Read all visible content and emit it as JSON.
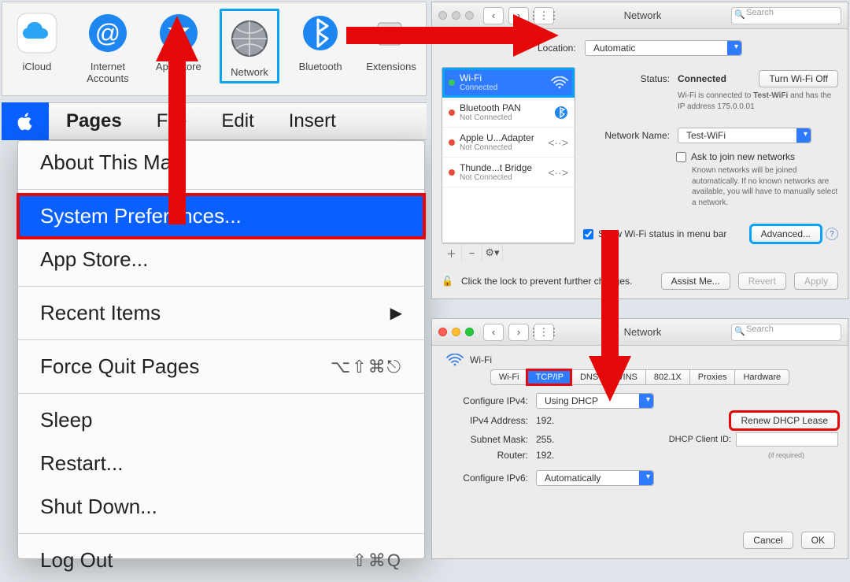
{
  "sp_icons": {
    "icloud": "iCloud",
    "internet": "Internet\nAccounts",
    "appstore": "App Store",
    "network": "Network",
    "bluetooth": "Bluetooth",
    "extensions": "Extensions"
  },
  "menubar": {
    "app": "Pages",
    "items": [
      "File",
      "Edit",
      "Insert"
    ]
  },
  "dropdown": {
    "about": "About This Mac",
    "sysprefs": "System Preferences...",
    "appstore": "App Store...",
    "recent": "Recent Items",
    "forcequit": "Force Quit Pages",
    "forcequit_shortcut": "⌥⇧⌘⎋",
    "sleep": "Sleep",
    "restart": "Restart...",
    "shutdown": "Shut Down...",
    "logout": "Log Out",
    "logout_shortcut": "⇧⌘Q"
  },
  "net1": {
    "title": "Network",
    "search_placeholder": "Search",
    "location_label": "Location:",
    "location_value": "Automatic",
    "sidebar": [
      {
        "name": "Wi-Fi",
        "sub": "Connected",
        "status": "g",
        "icon": "wifi"
      },
      {
        "name": "Bluetooth PAN",
        "sub": "Not Connected",
        "status": "r",
        "icon": "bt"
      },
      {
        "name": "Apple U...Adapter",
        "sub": "Not Connected",
        "status": "r",
        "icon": "eth"
      },
      {
        "name": "Thunde...t Bridge",
        "sub": "Not Connected",
        "status": "r",
        "icon": "eth"
      }
    ],
    "status_label": "Status:",
    "status_value": "Connected",
    "turn_off": "Turn Wi-Fi Off",
    "connected_text_pre": "Wi-Fi is connected to ",
    "connected_ssid": "Test-WiFi",
    "connected_text_post": " and has the IP address ",
    "ip": "175.0.0.01",
    "netname_label": "Network Name:",
    "netname_value": "Test-WiFi",
    "ask_label": "Ask to join new networks",
    "ask_help": "Known networks will be joined automatically. If no known networks are available, you will have to manually select a network.",
    "show_status": "Show Wi-Fi status in menu bar",
    "advanced": "Advanced...",
    "lock_text": "Click the lock to prevent further changes.",
    "assist": "Assist Me...",
    "revert": "Revert",
    "apply": "Apply"
  },
  "net2": {
    "title": "Network",
    "search_placeholder": "Search",
    "wifi_label": "Wi-Fi",
    "tabs": [
      "Wi-Fi",
      "TCP/IP",
      "DNS",
      "WINS",
      "802.1X",
      "Proxies",
      "Hardware"
    ],
    "active_tab": 1,
    "cfg4_label": "Configure IPv4:",
    "cfg4_value": "Using DHCP",
    "ipv4_label": "IPv4 Address:",
    "ipv4_value": "192.",
    "mask_label": "Subnet Mask:",
    "mask_value": "255.",
    "router_label": "Router:",
    "router_value": "192.",
    "renew": "Renew DHCP Lease",
    "clientid_label": "DHCP Client ID:",
    "clientid_note": "(if required)",
    "cfg6_label": "Configure IPv6:",
    "cfg6_value": "Automatically",
    "cancel": "Cancel",
    "ok": "OK"
  }
}
